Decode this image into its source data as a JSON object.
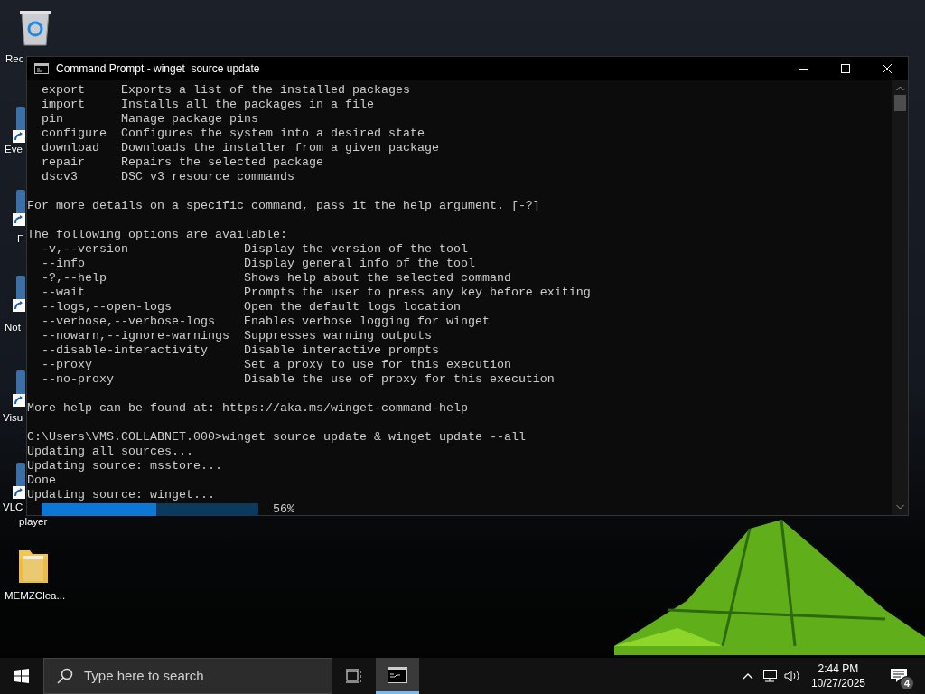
{
  "desktop_icons": [
    {
      "kind": "bin",
      "lines": [
        "Rec"
      ]
    },
    {
      "kind": "shortcut",
      "lines": [
        "Eve"
      ]
    },
    {
      "kind": "shortcut",
      "lines": [
        "F"
      ]
    },
    {
      "kind": "shortcut",
      "lines": [
        "Not"
      ]
    },
    {
      "kind": "shortcut",
      "lines": [
        "Visu"
      ]
    },
    {
      "kind": "shortcut",
      "lines": [
        "VLC",
        "player"
      ]
    },
    {
      "kind": "folder",
      "lines": [
        "MEMZClea..."
      ]
    }
  ],
  "window": {
    "title": "Command Prompt - winget  source update",
    "console": {
      "blocks": [
        [
          "  export     Exports a list of the installed packages",
          "  import     Installs all the packages in a file",
          "  pin        Manage package pins",
          "  configure  Configures the system into a desired state",
          "  download   Downloads the installer from a given package",
          "  repair     Repairs the selected package",
          "  dscv3      DSC v3 resource commands"
        ],
        [
          "For more details on a specific command, pass it the help argument. [-?]"
        ],
        [
          "The following options are available:",
          "  -v,--version                Display the version of the tool",
          "  --info                      Display general info of the tool",
          "  -?,--help                   Shows help about the selected command",
          "  --wait                      Prompts the user to press any key before exiting",
          "  --logs,--open-logs          Open the default logs location",
          "  --verbose,--verbose-logs    Enables verbose logging for winget",
          "  --nowarn,--ignore-warnings  Suppresses warning outputs",
          "  --disable-interactivity     Disable interactive prompts",
          "  --proxy                     Set a proxy to use for this execution",
          "  --no-proxy                  Disable the use of proxy for this execution"
        ],
        [
          "More help can be found at: https://aka.ms/winget-command-help"
        ],
        [
          "C:\\Users\\VMS.COLLABNET.000>winget source update & winget update --all",
          "Updating all sources...",
          "Updating source: msstore...",
          "Done",
          "Updating source: winget..."
        ]
      ],
      "progress": {
        "level": 0.53,
        "reading": "56%"
      }
    }
  },
  "taskbar": {
    "search": {
      "placeholder": "Type here to search"
    },
    "apps": [
      {
        "selected": true
      }
    ],
    "clock": {
      "time": "2:44 PM",
      "date": "10/27/2025"
    },
    "notifications": {
      "count": "4"
    }
  }
}
